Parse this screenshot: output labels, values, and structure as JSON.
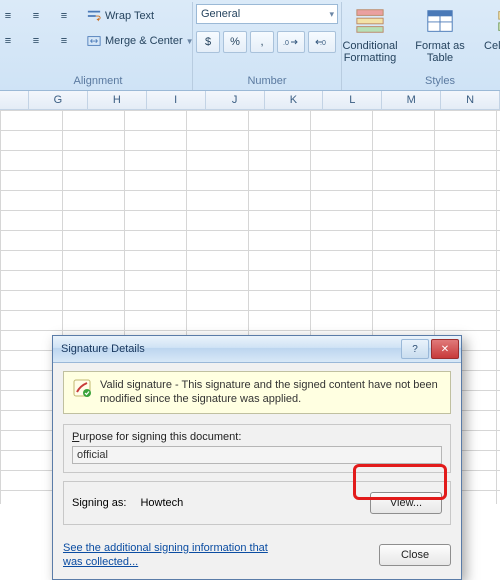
{
  "ribbon": {
    "alignment": {
      "label": "Alignment",
      "wrap": "Wrap Text",
      "merge": "Merge & Center"
    },
    "number": {
      "label": "Number",
      "format": "General",
      "currency": "$",
      "percent": "%",
      "comma": ",",
      "inc": ".0→",
      "dec": "→.0"
    },
    "styles": {
      "label": "Styles",
      "cond": "Conditional Formatting",
      "table": "Format as Table",
      "cell": "Cell Styles"
    }
  },
  "columns": [
    "G",
    "H",
    "I",
    "J",
    "K",
    "L",
    "M",
    "N"
  ],
  "dialog": {
    "title": "Signature Details",
    "info": "Valid signature - This signature and the signed content have not been modified since the signature was applied.",
    "purpose_label": "Purpose for signing this document:",
    "purpose_value": "official",
    "signing_as_label": "Signing as:",
    "signing_as_value": "Howtech",
    "view_btn": "View...",
    "link": "See the additional signing information that was collected...",
    "close_btn": "Close"
  }
}
